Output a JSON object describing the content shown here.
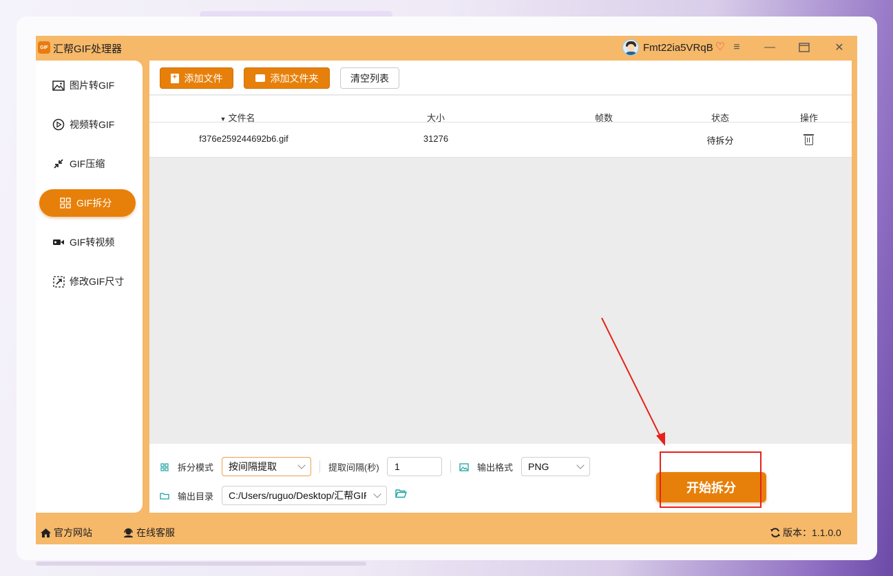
{
  "app": {
    "title": "汇帮GIF处理器",
    "logo_text": "GIF"
  },
  "user": {
    "name": "Fmt22ia5VRqB",
    "badge_icon": "vip-heart-icon"
  },
  "window_controls": [
    "menu-icon",
    "minimize-icon",
    "maximize-icon",
    "close-icon"
  ],
  "sidebar": {
    "items": [
      {
        "label": "图片转GIF",
        "icon": "image-icon",
        "active": false
      },
      {
        "label": "视频转GIF",
        "icon": "play-circle-icon",
        "active": false
      },
      {
        "label": "GIF压缩",
        "icon": "compress-icon",
        "active": false
      },
      {
        "label": "GIF拆分",
        "icon": "split-grid-icon",
        "active": true
      },
      {
        "label": "GIF转视频",
        "icon": "video-camera-icon",
        "active": false
      },
      {
        "label": "修改GIF尺寸",
        "icon": "resize-icon",
        "active": false
      }
    ]
  },
  "toolbar": {
    "add_file": "添加文件",
    "add_folder": "添加文件夹",
    "clear_list": "清空列表"
  },
  "table": {
    "columns": {
      "name": "文件名",
      "size": "大小",
      "frames": "帧数",
      "status": "状态",
      "actions": "操作"
    },
    "sort_indicator": "▼",
    "rows": [
      {
        "name": "f376e259244692b6.gif",
        "size": "31276",
        "frames": "",
        "status": "待拆分"
      }
    ]
  },
  "settings": {
    "split_mode_label": "拆分模式",
    "split_mode_value": "按间隔提取",
    "interval_label": "提取间隔(秒)",
    "interval_value": "1",
    "output_format_label": "输出格式",
    "output_format_value": "PNG",
    "output_dir_label": "输出目录",
    "output_dir_value": "C:/Users/ruguo/Desktop/汇帮GIF"
  },
  "start_button": "开始拆分",
  "footer": {
    "website": "官方网站",
    "support": "在线客服",
    "version": "版本：1.1.0.0"
  },
  "colors": {
    "accent": "#e7800a",
    "frame": "#f6b869",
    "annotation": "#e8201b"
  }
}
